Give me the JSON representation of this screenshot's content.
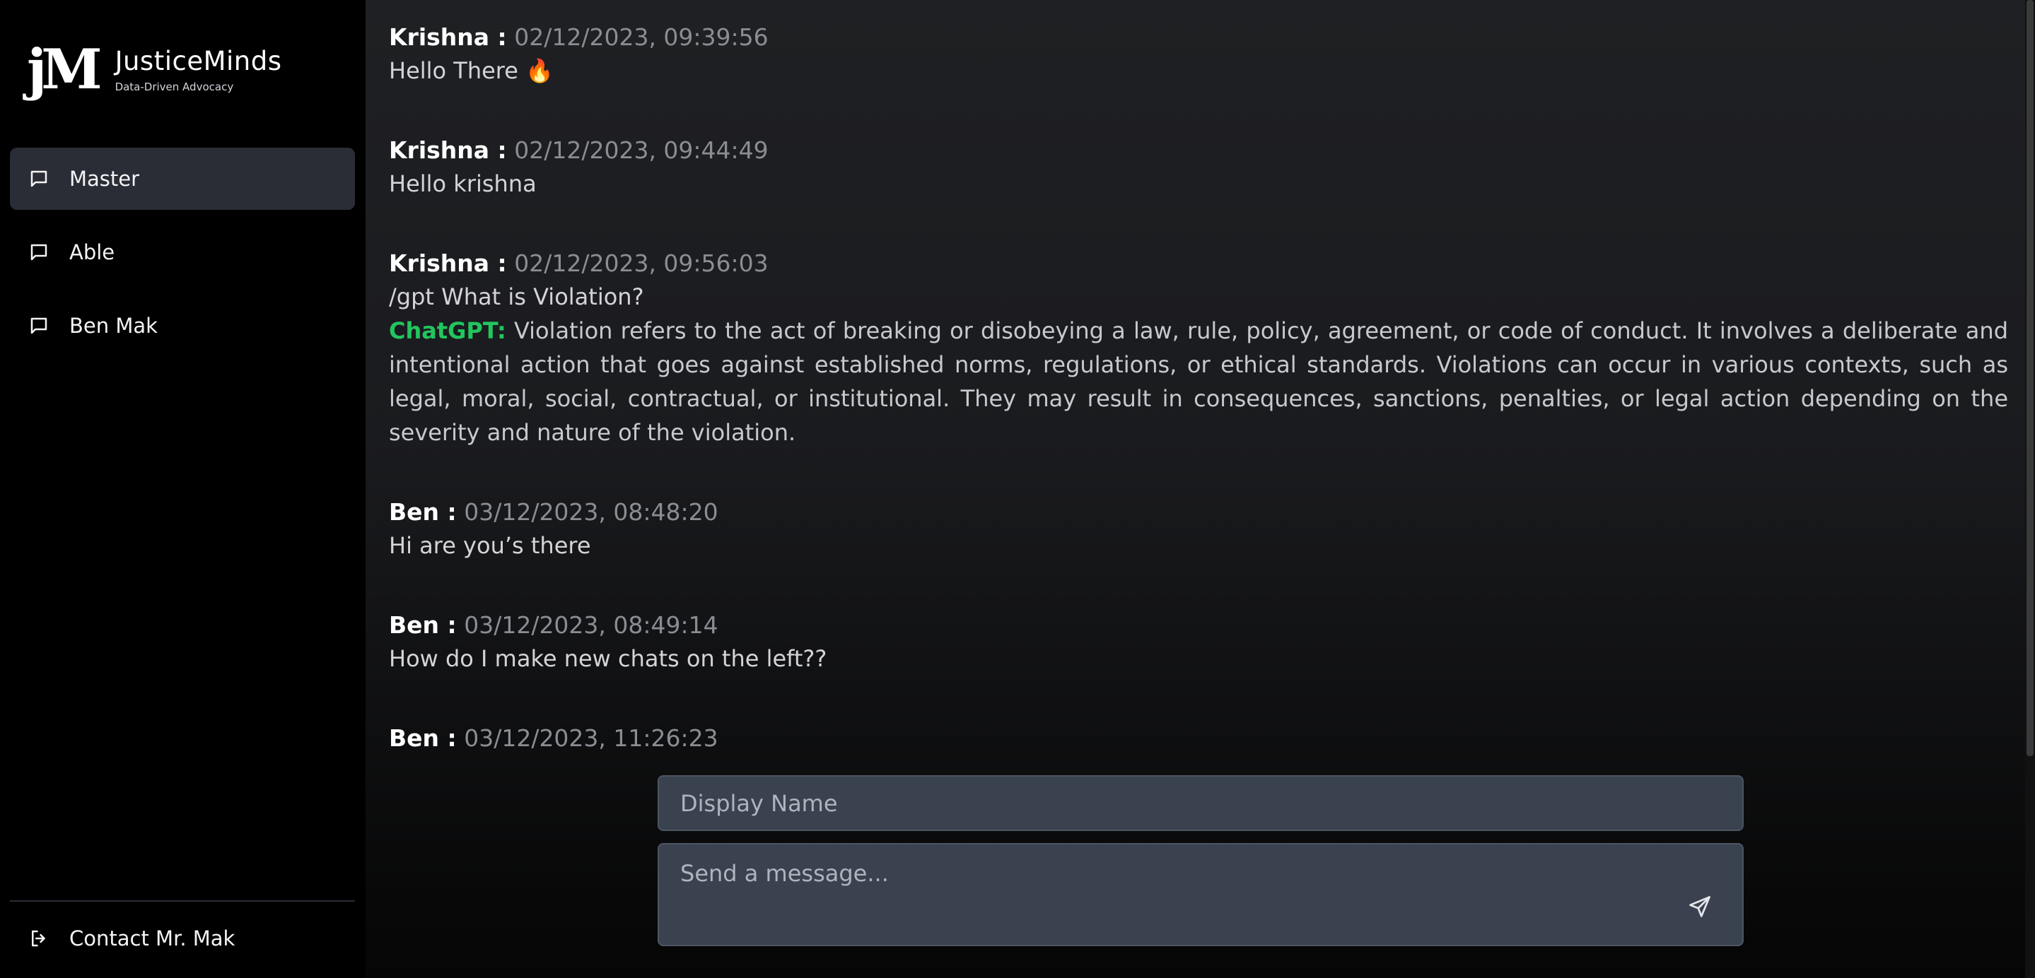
{
  "brand": {
    "mark": "jM",
    "title": "JusticeMinds",
    "subtitle": "Data-Driven Advocacy"
  },
  "sidebar": {
    "items": [
      {
        "label": "Master",
        "icon": "chat-bubble-icon",
        "active": true
      },
      {
        "label": "Able",
        "icon": "chat-bubble-icon",
        "active": false
      },
      {
        "label": "Ben Mak",
        "icon": "chat-bubble-icon",
        "active": false
      }
    ],
    "contact": {
      "label": "Contact Mr. Mak",
      "icon": "logout-icon"
    }
  },
  "messages": [
    {
      "author": "Krishna :",
      "time": "02/12/2023, 09:39:56",
      "text": "Hello There 🔥"
    },
    {
      "author": "Krishna :",
      "time": "02/12/2023, 09:44:49",
      "text": "Hello krishna"
    },
    {
      "author": "Krishna :",
      "time": "02/12/2023, 09:56:03",
      "text": "/gpt What is Violation?",
      "gpt_label": "ChatGPT:",
      "gpt_text": "Violation refers to the act of breaking or disobeying a law, rule, policy, agreement, or code of conduct. It involves a deliberate and intentional action that goes against established norms, regulations, or ethical standards. Violations can occur in various contexts, such as legal, moral, social, contractual, or institutional. They may result in consequences, sanctions, penalties, or legal action depending on the severity and nature of the violation."
    },
    {
      "author": "Ben :",
      "time": "03/12/2023, 08:48:20",
      "text": "Hi are you’s there"
    },
    {
      "author": "Ben :",
      "time": "03/12/2023, 08:49:14",
      "text": "How do I make new chats on the left??"
    },
    {
      "author": "Ben :",
      "time": "03/12/2023, 11:26:23",
      "text": ""
    }
  ],
  "composer": {
    "display_name_placeholder": "Display Name",
    "message_placeholder": "Send a message...",
    "send_icon": "send-icon"
  },
  "colors": {
    "sidebar_bg": "#000000",
    "active_item_bg": "#2a2d36",
    "gpt_label": "#22c55e",
    "input_bg": "#3a4250"
  }
}
